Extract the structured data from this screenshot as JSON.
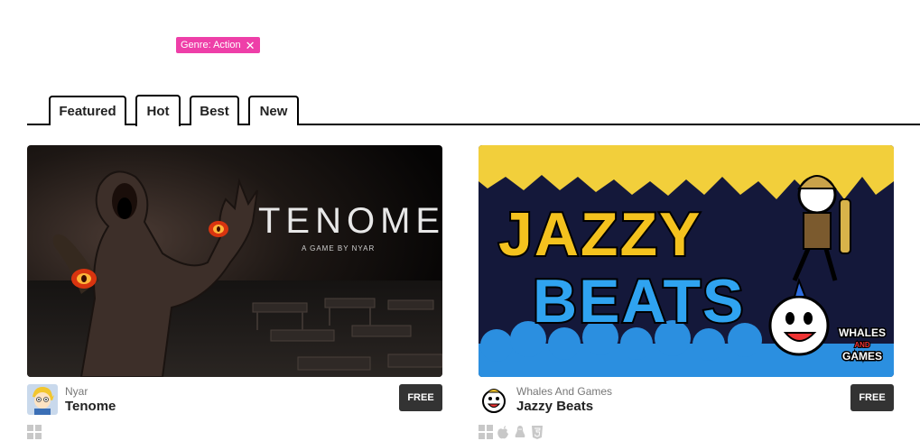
{
  "filter": {
    "label": "Genre: Action",
    "remove_icon": "close-icon"
  },
  "tabs": [
    {
      "label": "Featured",
      "active": false
    },
    {
      "label": "Hot",
      "active": true
    },
    {
      "label": "Best",
      "active": false
    },
    {
      "label": "New",
      "active": false
    }
  ],
  "games": [
    {
      "studio": "Nyar",
      "title": "Tenome",
      "price": "FREE",
      "cover_title": "TENOME",
      "cover_subtitle": "A GAME BY NYAR",
      "platforms": [
        "windows-icon"
      ]
    },
    {
      "studio": "Whales And Games",
      "title": "Jazzy Beats",
      "price": "FREE",
      "cover_title_line1": "JAZZY",
      "cover_title_line2": "BEATS",
      "cover_logo_line1": "WHALES",
      "cover_logo_line2": "AND",
      "cover_logo_line3": "GAMES",
      "platforms": [
        "windows-icon",
        "apple-icon",
        "linux-icon",
        "html5-icon"
      ]
    }
  ],
  "colors": {
    "tag_pink": "#ee3fa8",
    "price_bg": "#333333"
  }
}
